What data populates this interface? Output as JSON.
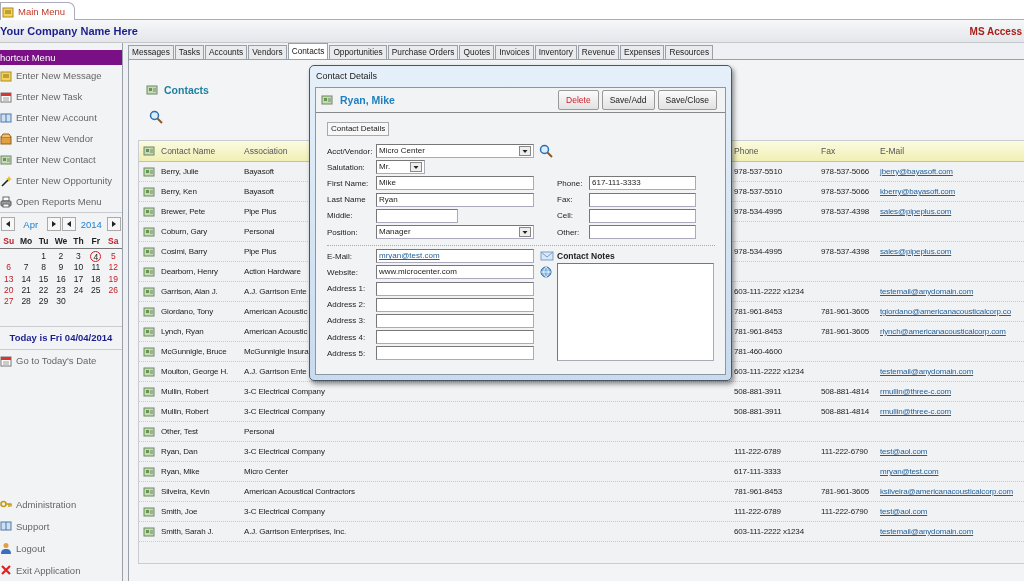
{
  "app_tab": {
    "label": "Main Menu",
    "selected": true
  },
  "header": {
    "company": "Your Company Name Here",
    "product": "MS Access"
  },
  "sidebar": {
    "title": "hortcut Menu",
    "items": [
      "Enter New Message",
      "Enter New Task",
      "Enter New Account",
      "Enter New Vendor",
      "Enter New Contact",
      "Enter New Opportunity",
      "Open Reports Menu"
    ],
    "calendar": {
      "month": "Apr",
      "year": "2014",
      "weekdays": [
        "Su",
        "Mo",
        "Tu",
        "We",
        "Th",
        "Fr",
        "Sa"
      ],
      "weeks": [
        {
          "days": [
            {
              "label": "1",
              "selected": false
            },
            {
              "label": "2",
              "selected": false
            },
            {
              "label": "3",
              "selected": false
            },
            {
              "label": "4",
              "selected": true
            },
            {
              "label": "5",
              "selected": false
            }
          ]
        },
        {
          "days": [
            {
              "label": "6",
              "selected": false
            },
            {
              "label": "7",
              "selected": false
            },
            {
              "label": "8",
              "selected": false
            },
            {
              "label": "9",
              "selected": false
            },
            {
              "label": "10",
              "selected": false
            },
            {
              "label": "11",
              "selected": false
            },
            {
              "label": "12",
              "selected": false
            }
          ]
        },
        {
          "days": [
            {
              "label": "13",
              "selected": false
            },
            {
              "label": "14",
              "selected": false
            },
            {
              "label": "15",
              "selected": false
            },
            {
              "label": "16",
              "selected": false
            },
            {
              "label": "17",
              "selected": false
            },
            {
              "label": "18",
              "selected": false
            },
            {
              "label": "19",
              "selected": false
            }
          ]
        },
        {
          "days": [
            {
              "label": "20",
              "selected": false
            },
            {
              "label": "21",
              "selected": false
            },
            {
              "label": "22",
              "selected": false
            },
            {
              "label": "23",
              "selected": false
            },
            {
              "label": "24",
              "selected": false
            },
            {
              "label": "25",
              "selected": false
            },
            {
              "label": "26",
              "selected": false
            }
          ]
        },
        {
          "days": [
            {
              "label": "27",
              "selected": false
            },
            {
              "label": "28",
              "selected": false
            },
            {
              "label": "29",
              "selected": false
            },
            {
              "label": "30",
              "selected": false
            }
          ]
        }
      ]
    },
    "today_text": "Today is Fri 04/04/2014",
    "today_link": "Go to Today's Date",
    "footer_items": [
      "Administration",
      "Support",
      "Logout",
      "Exit Application"
    ]
  },
  "tabs": [
    {
      "label": "Messages",
      "selected": false
    },
    {
      "label": "Tasks",
      "selected": false
    },
    {
      "label": "Accounts",
      "selected": false
    },
    {
      "label": "Vendors",
      "selected": false
    },
    {
      "label": "Contacts",
      "selected": true
    },
    {
      "label": "Opportunities",
      "selected": false
    },
    {
      "label": "Purchase Orders",
      "selected": false
    },
    {
      "label": "Quotes",
      "selected": false
    },
    {
      "label": "Invoices",
      "selected": false
    },
    {
      "label": "Inventory",
      "selected": false
    },
    {
      "label": "Revenue",
      "selected": false
    },
    {
      "label": "Expenses",
      "selected": false
    },
    {
      "label": "Resources",
      "selected": false
    }
  ],
  "contacts": {
    "title": "Contacts",
    "columns": [
      "Contact Name",
      "Association",
      "Phone",
      "Fax",
      "E-Mail"
    ],
    "rows": [
      {
        "name": "Berry, Julie",
        "association": "Bayasoft",
        "phone": "978-537-5510",
        "fax": "978-537-5066",
        "email": "jberry@bayasoft.com"
      },
      {
        "name": "Berry, Ken",
        "association": "Bayasoft",
        "phone": "978-537-5510",
        "fax": "978-537-5066",
        "email": "kberry@bayasoft.com"
      },
      {
        "name": "Brewer, Pete",
        "association": "Pipe Plus",
        "phone": "978-534-4995",
        "fax": "978-537-4398",
        "email": "sales@pipeplus.com"
      },
      {
        "name": "Coburn, Gary",
        "association": "Personal"
      },
      {
        "name": "Cosimi, Barry",
        "association": "Pipe Plus",
        "phone": "978-534-4995",
        "fax": "978-537-4398",
        "email": "sales@pipeplus.com"
      },
      {
        "name": "Dearborn, Henry",
        "association": "Action Hardware"
      },
      {
        "name": "Garrison, Alan J.",
        "association": "A.J. Garrison Ente",
        "phone": "603-111-2222 x1234",
        "email": "testemail@anydomain.com"
      },
      {
        "name": "Giordano, Tony",
        "association": "American Acoustic",
        "phone": "781-961-8453",
        "fax": "781-961-3605",
        "email": "tgiordano@americanacousticalcorp.co"
      },
      {
        "name": "Lynch, Ryan",
        "association": "American Acoustic",
        "phone": "781-961-8453",
        "fax": "781-961-3605",
        "email": "rlynch@americanacousticalcorp.com"
      },
      {
        "name": "McGunnigle, Bruce",
        "association": "McGunnigle Insura",
        "phone": "781-460-4600"
      },
      {
        "name": "Moulton, George H.",
        "association": "A.J. Garrison Ente",
        "phone": "603-111-2222 x1234",
        "email": "testemail@anydomain.com"
      },
      {
        "name": "Mullin, Robert",
        "association": "3-C Electrical Company",
        "phone": "508-881-3911",
        "fax": "508-881-4814",
        "email": "rmullin@three-c.com"
      },
      {
        "name": "Mullin, Robert",
        "association": "3-C Electrical Company",
        "phone": "508-881-3911",
        "fax": "508-881-4814",
        "email": "rmullin@three-c.com"
      },
      {
        "name": "Other, Test",
        "association": "Personal"
      },
      {
        "name": "Ryan, Dan",
        "association": "3-C Electrical Company",
        "phone": "111-222-6789",
        "fax": "111-222-6790",
        "email": "test@aol.com"
      },
      {
        "name": "Ryan, Mike",
        "association": "Micro Center",
        "phone": "617-111-3333",
        "email": "mryan@test.com"
      },
      {
        "name": "Silveira, Kevin",
        "association": "American Acoustical Contractors",
        "phone": "781-961-8453",
        "fax": "781-961-3605",
        "email": "ksilveira@americanacousticalcorp.com"
      },
      {
        "name": "Smith, Joe",
        "association": "3-C Electrical Company",
        "phone": "111-222-6789",
        "fax": "111-222-6790",
        "email": "test@aol.com"
      },
      {
        "name": "Smith, Sarah J.",
        "association": "A.J. Garrison Enterprises, Inc.",
        "phone": "603-111-2222 x1234",
        "email": "testemail@anydomain.com"
      }
    ]
  },
  "dialog": {
    "title": "Contact Details",
    "heading": "Ryan, Mike",
    "buttons": [
      {
        "label": "Delete",
        "kind": "delete"
      },
      {
        "label": "Save/Add",
        "kind": "normal"
      },
      {
        "label": "Save/Close",
        "kind": "normal"
      }
    ],
    "section_tab": "Contact Details",
    "main_fields": [
      {
        "label": "Acct/Vendor:",
        "value": "Micro Center",
        "kind": "combo"
      },
      {
        "label": "Salutation:",
        "value": "Mr.",
        "kind": "combo"
      },
      {
        "label": "First Name:",
        "value": "Mike",
        "kind": "text"
      },
      {
        "label": "Last Name",
        "value": "Ryan",
        "kind": "text"
      },
      {
        "label": "Middle:",
        "kind": "text"
      },
      {
        "label": "Position:",
        "value": "Manager",
        "kind": "combo"
      }
    ],
    "phone_fields": [
      {
        "label": "Phone:",
        "value": "617-111-3333"
      },
      {
        "label": "Fax:"
      },
      {
        "label": "Cell:"
      },
      {
        "label": "Other:"
      }
    ],
    "contact_fields": [
      {
        "label": "E-Mail:",
        "value": "mryan@test.com",
        "kind": "link"
      },
      {
        "label": "Website:",
        "value": "www.microcenter.com",
        "kind": "text"
      },
      {
        "label": "Address 1:",
        "kind": "text"
      },
      {
        "label": "Address 2:",
        "kind": "text"
      },
      {
        "label": "Address 3:",
        "kind": "text"
      },
      {
        "label": "Address 4:",
        "kind": "text"
      },
      {
        "label": "Address 5:",
        "kind": "text"
      }
    ],
    "notes_label": "Contact Notes"
  }
}
